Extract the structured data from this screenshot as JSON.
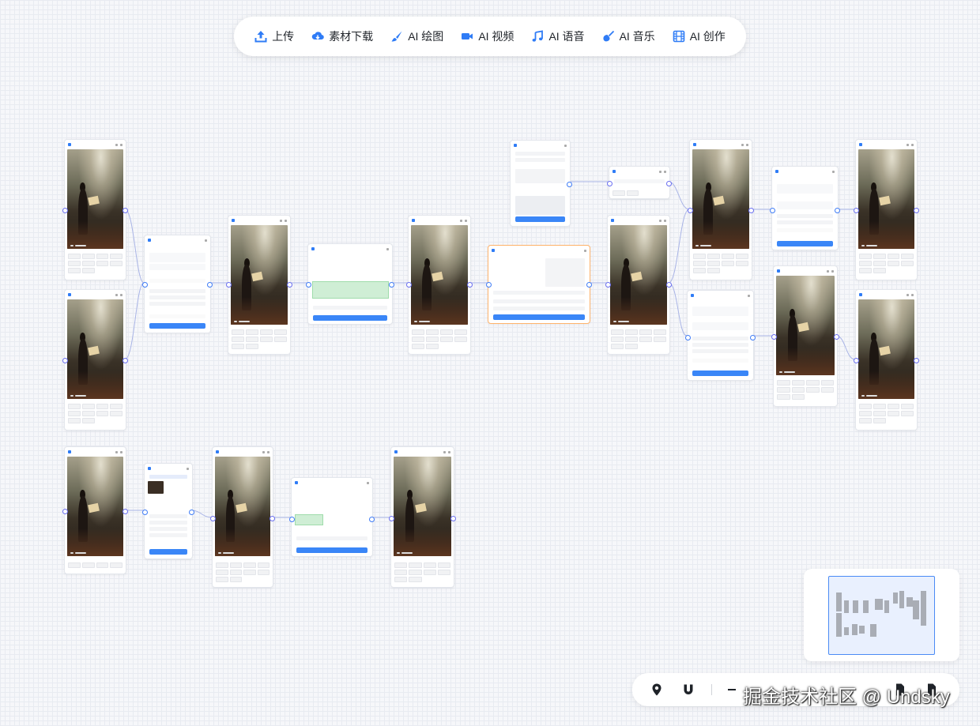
{
  "toolbar": {
    "items": [
      {
        "label": "上传",
        "icon": "upload-icon"
      },
      {
        "label": "素材下载",
        "icon": "cloud-download-icon"
      },
      {
        "label": "AI 绘图",
        "icon": "brush-icon"
      },
      {
        "label": "AI 视频",
        "icon": "video-camera-icon"
      },
      {
        "label": "AI 语音",
        "icon": "music-note-icon"
      },
      {
        "label": "AI 音乐",
        "icon": "guitar-icon"
      },
      {
        "label": "AI 创作",
        "icon": "film-icon"
      }
    ]
  },
  "colors": {
    "accent": "#2f7cf6",
    "port": "#6a6ff0",
    "selected_border": "#ffb36b",
    "button": "#3a86f7"
  },
  "controls": {
    "icons": [
      "location-pin-icon",
      "magnet-icon",
      "minus-icon",
      "file-export-icon",
      "file-import-icon"
    ]
  },
  "watermark": "掘金技术社区 @ Undsky"
}
